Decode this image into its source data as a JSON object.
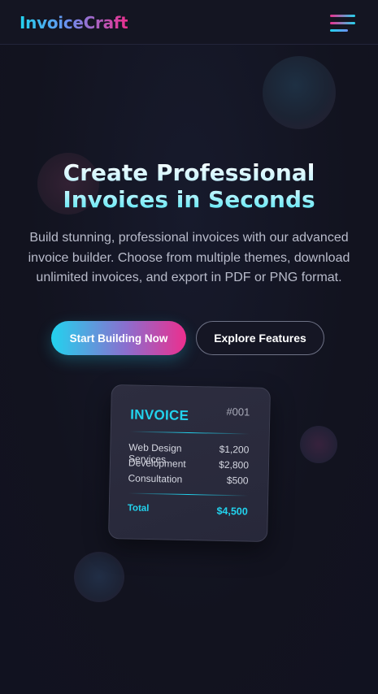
{
  "header": {
    "brand": "InvoiceCraft",
    "menu_icon": "hamburger-menu-icon"
  },
  "hero": {
    "title_line1": "Create Professional",
    "title_line2": "Invoices in Seconds",
    "subtitle": "Build stunning, professional invoices with our advanced invoice builder. Choose from multiple themes, download unlimited invoices, and export in PDF or PNG format.",
    "primary_button": "Start Building Now",
    "secondary_button": "Explore Features"
  },
  "invoice_preview": {
    "title": "INVOICE",
    "number": "#001",
    "items": [
      {
        "name": "Web Design Services",
        "amount": "$1,200"
      },
      {
        "name": "Development",
        "amount": "$2,800"
      },
      {
        "name": "Consultation",
        "amount": "$500"
      }
    ],
    "total_label": "Total",
    "total_value": "$4,500"
  },
  "colors": {
    "accent_cyan": "#22d3ee",
    "accent_pink": "#ec2f8e",
    "background": "#12131f"
  }
}
